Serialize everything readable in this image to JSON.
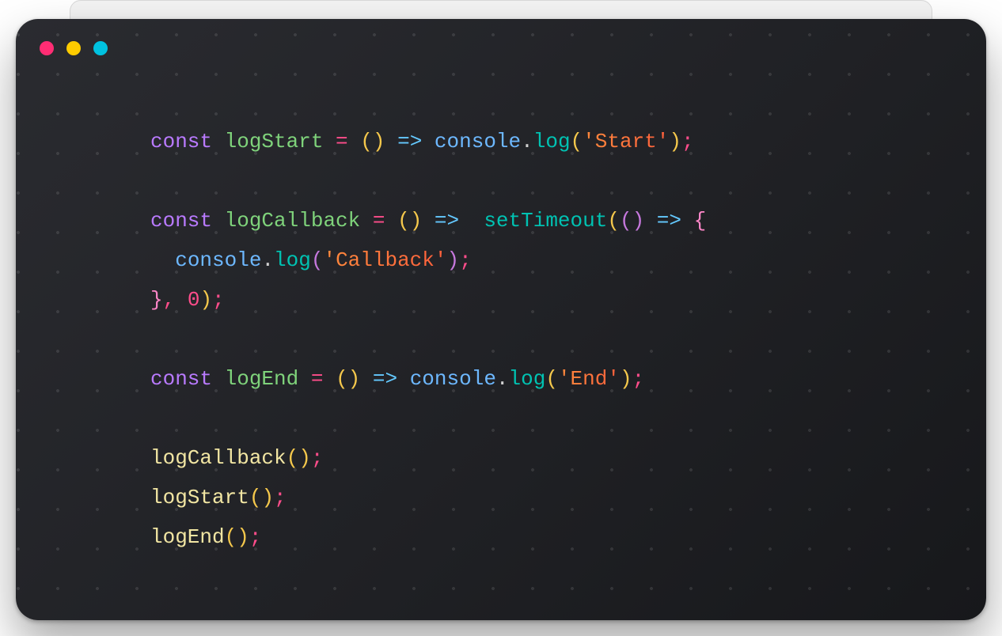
{
  "window": {
    "traffic_lights": [
      "close",
      "minimize",
      "zoom"
    ]
  },
  "code": {
    "lines": [
      [
        {
          "t": "const ",
          "c": "c-kw"
        },
        {
          "t": "logStart",
          "c": "c-fn"
        },
        {
          "t": " = ",
          "c": "c-op"
        },
        {
          "t": "(",
          "c": "c-ylw"
        },
        {
          "t": ")",
          "c": "c-ylw"
        },
        {
          "t": " => ",
          "c": "c-blu"
        },
        {
          "t": "console",
          "c": "c-obj"
        },
        {
          "t": ".",
          "c": "c-dot"
        },
        {
          "t": "log",
          "c": "c-call"
        },
        {
          "t": "(",
          "c": "c-ylw"
        },
        {
          "t": "'Start'",
          "c": "c-str"
        },
        {
          "t": ")",
          "c": "c-ylw"
        },
        {
          "t": ";",
          "c": "c-op"
        }
      ],
      [],
      [
        {
          "t": "const ",
          "c": "c-kw"
        },
        {
          "t": "logCallback",
          "c": "c-fn"
        },
        {
          "t": " = ",
          "c": "c-op"
        },
        {
          "t": "(",
          "c": "c-ylw"
        },
        {
          "t": ")",
          "c": "c-ylw"
        },
        {
          "t": " =>  ",
          "c": "c-blu"
        },
        {
          "t": "setTimeout",
          "c": "c-call"
        },
        {
          "t": "(",
          "c": "c-ylw"
        },
        {
          "t": "(",
          "c": "c-par2"
        },
        {
          "t": ")",
          "c": "c-par2"
        },
        {
          "t": " => ",
          "c": "c-blu"
        },
        {
          "t": "{",
          "c": "c-pnk"
        }
      ],
      [
        {
          "t": "  ",
          "c": ""
        },
        {
          "t": "console",
          "c": "c-obj"
        },
        {
          "t": ".",
          "c": "c-dot"
        },
        {
          "t": "log",
          "c": "c-call"
        },
        {
          "t": "(",
          "c": "c-par2"
        },
        {
          "t": "'Callback'",
          "c": "c-str"
        },
        {
          "t": ")",
          "c": "c-par2"
        },
        {
          "t": ";",
          "c": "c-op"
        }
      ],
      [
        {
          "t": "}",
          "c": "c-pnk"
        },
        {
          "t": ", ",
          "c": "c-op"
        },
        {
          "t": "0",
          "c": "c-num"
        },
        {
          "t": ")",
          "c": "c-ylw"
        },
        {
          "t": ";",
          "c": "c-op"
        }
      ],
      [],
      [
        {
          "t": "const ",
          "c": "c-kw"
        },
        {
          "t": "logEnd",
          "c": "c-fn"
        },
        {
          "t": " = ",
          "c": "c-op"
        },
        {
          "t": "(",
          "c": "c-ylw"
        },
        {
          "t": ")",
          "c": "c-ylw"
        },
        {
          "t": " => ",
          "c": "c-blu"
        },
        {
          "t": "console",
          "c": "c-obj"
        },
        {
          "t": ".",
          "c": "c-dot"
        },
        {
          "t": "log",
          "c": "c-call"
        },
        {
          "t": "(",
          "c": "c-ylw"
        },
        {
          "t": "'End'",
          "c": "c-str"
        },
        {
          "t": ")",
          "c": "c-ylw"
        },
        {
          "t": ";",
          "c": "c-op"
        }
      ],
      [],
      [
        {
          "t": "logCallback",
          "c": "c-name"
        },
        {
          "t": "(",
          "c": "c-ylw"
        },
        {
          "t": ")",
          "c": "c-ylw"
        },
        {
          "t": ";",
          "c": "c-op"
        }
      ],
      [
        {
          "t": "logStart",
          "c": "c-name"
        },
        {
          "t": "(",
          "c": "c-ylw"
        },
        {
          "t": ")",
          "c": "c-ylw"
        },
        {
          "t": ";",
          "c": "c-op"
        }
      ],
      [
        {
          "t": "logEnd",
          "c": "c-name"
        },
        {
          "t": "(",
          "c": "c-ylw"
        },
        {
          "t": ")",
          "c": "c-ylw"
        },
        {
          "t": ";",
          "c": "c-op"
        }
      ]
    ]
  }
}
